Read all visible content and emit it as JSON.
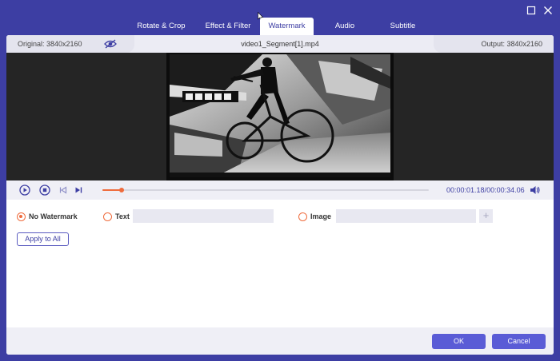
{
  "tabs": [
    {
      "label": "Rotate & Crop",
      "active": false
    },
    {
      "label": "Effect & Filter",
      "active": false
    },
    {
      "label": "Watermark",
      "active": true
    },
    {
      "label": "Audio",
      "active": false
    },
    {
      "label": "Subtitle",
      "active": false
    }
  ],
  "info": {
    "original": "Original: 3840x2160",
    "filename": "video1_Segment[1].mp4",
    "output": "Output: 3840x2160"
  },
  "playback": {
    "current_time": "00:00:01.18",
    "separator": "/",
    "total_time": "00:00:34.06",
    "progress_fraction": 0.058
  },
  "watermark": {
    "no_watermark_label": "No Watermark",
    "text_label": "Text",
    "text_value": "",
    "image_label": "Image",
    "image_value": "",
    "add_symbol": "+",
    "selected": "none"
  },
  "apply_to_all_label": "Apply to All",
  "footer": {
    "ok_label": "OK",
    "cancel_label": "Cancel"
  },
  "icons": [
    "maximize-icon",
    "close-icon",
    "eye-hidden-icon",
    "play-icon",
    "stop-icon",
    "previous-frame-icon",
    "next-frame-icon",
    "volume-icon"
  ],
  "colors": {
    "window_bg": "#3d3ea3",
    "accent": "#ef6b3c",
    "button": "#5a5cd6"
  }
}
